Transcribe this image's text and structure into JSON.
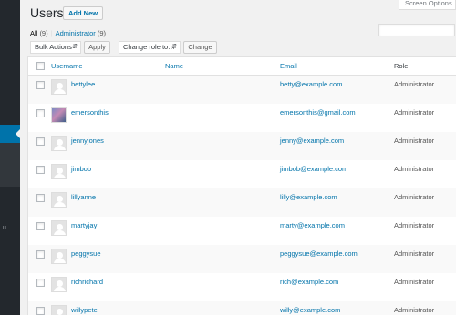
{
  "screen_options": "Screen Options",
  "page": {
    "title": "Users",
    "add_new": "Add New"
  },
  "filters": {
    "all_label": "All",
    "all_count": "(9)",
    "sep": "|",
    "admin_label": "Administrator",
    "admin_count": "(9)"
  },
  "bulk": {
    "actions_selected": "Bulk Actions",
    "apply": "Apply",
    "role_selected": "Change role to…",
    "change": "Change"
  },
  "columns": {
    "username": "Username",
    "name": "Name",
    "email": "Email",
    "role": "Role"
  },
  "users": [
    {
      "username": "bettylee",
      "name": "",
      "email": "betty@example.com",
      "role": "Administrator",
      "avatar": "default"
    },
    {
      "username": "emersonthis",
      "name": "",
      "email": "emersonthis@gmail.com",
      "role": "Administrator",
      "avatar": "photo"
    },
    {
      "username": "jennyjones",
      "name": "",
      "email": "jenny@example.com",
      "role": "Administrator",
      "avatar": "default"
    },
    {
      "username": "jimbob",
      "name": "",
      "email": "jimbob@example.com",
      "role": "Administrator",
      "avatar": "default"
    },
    {
      "username": "lillyanne",
      "name": "",
      "email": "lilly@example.com",
      "role": "Administrator",
      "avatar": "default"
    },
    {
      "username": "martyjay",
      "name": "",
      "email": "marty@example.com",
      "role": "Administrator",
      "avatar": "default"
    },
    {
      "username": "peggysue",
      "name": "",
      "email": "peggysue@example.com",
      "role": "Administrator",
      "avatar": "default"
    },
    {
      "username": "richrichard",
      "name": "",
      "email": "rich@example.com",
      "role": "Administrator",
      "avatar": "default"
    },
    {
      "username": "willypete",
      "name": "",
      "email": "willy@example.com",
      "role": "Administrator",
      "avatar": "default"
    }
  ],
  "menu": {
    "glyph": "u"
  },
  "colors": {
    "menu_bg": "#23282d",
    "accent": "#0073aa",
    "link": "#0073aa"
  }
}
